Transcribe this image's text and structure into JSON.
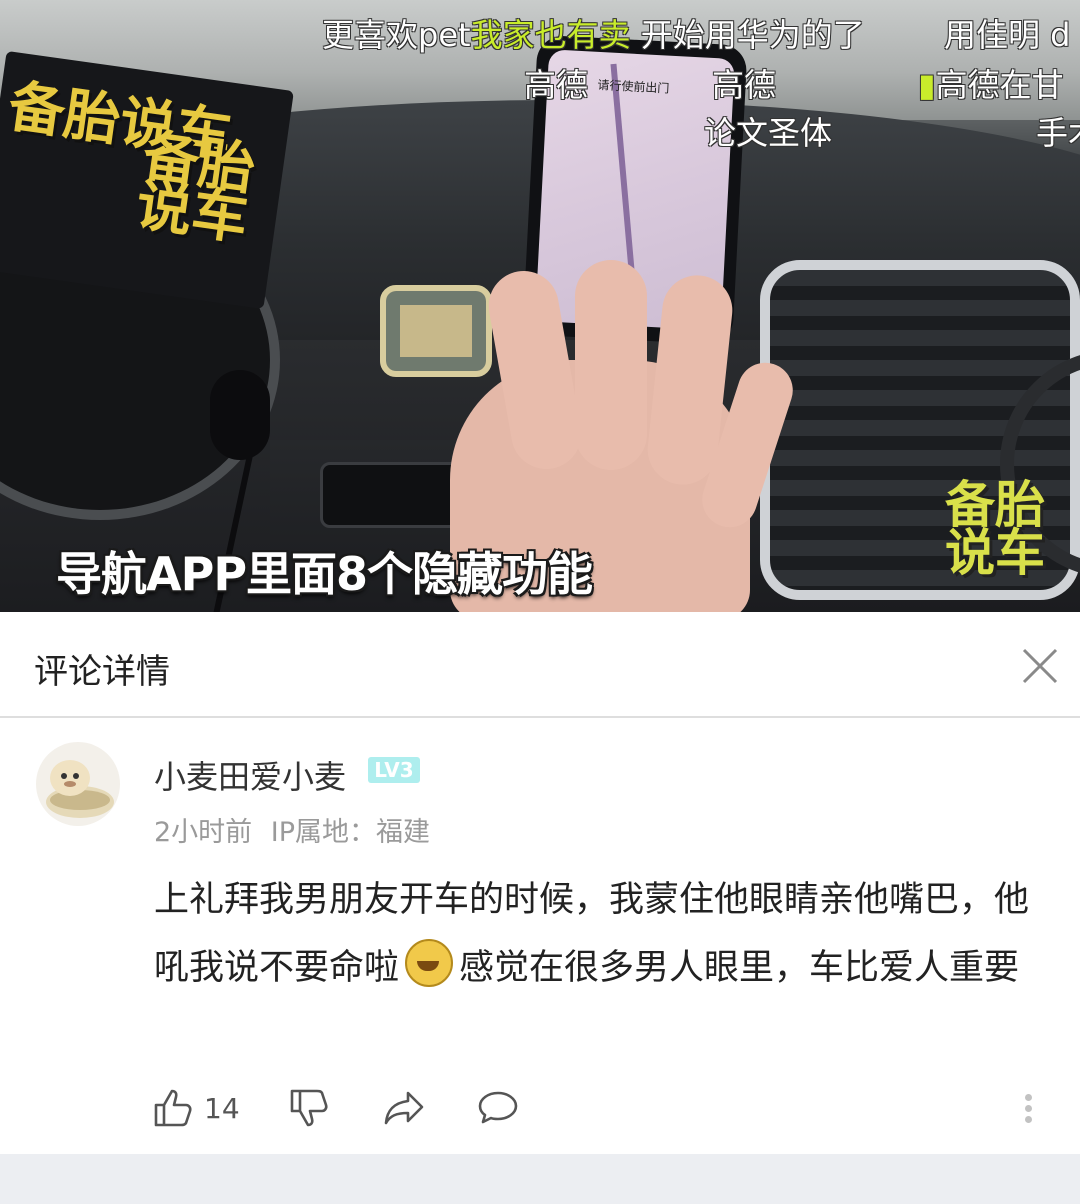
{
  "video": {
    "caption": "导航APP里面8个隐藏功能",
    "sign_text": "备胎说车",
    "watermark": "备胎说车",
    "phone_label": "请行使前出门",
    "danmaku": [
      {
        "pre": "更喜欢pet",
        "hl": "我家也有卖",
        "post": "开始用华为的了"
      },
      {
        "text": "用佳明 d"
      },
      {
        "text": "高德"
      },
      {
        "text": "高德"
      },
      {
        "text": "高德在甘"
      },
      {
        "text": "论文圣体"
      },
      {
        "text": "手术"
      }
    ]
  },
  "sheet": {
    "title": "评论详情"
  },
  "comment": {
    "username": "小麦田爱小麦",
    "level": "LV3",
    "time": "2小时前",
    "ip_location": "IP属地：福建",
    "content_before_emoji": "上礼拜我男朋友开车的时候，我蒙住他眼睛亲他嘴巴，他吼我说不要命啦",
    "emoji_name": "smiling-face-emoji",
    "content_after_emoji": "感觉在很多男人眼里，车比爱人重要",
    "like_count": "14"
  },
  "icons": {
    "close": "close-icon",
    "like": "thumbs-up-icon",
    "dislike": "thumbs-down-icon",
    "share": "share-icon",
    "reply": "comment-bubble-icon",
    "more": "more-vertical-icon"
  },
  "colors": {
    "danmaku_highlight": "#c9ec2b",
    "level_badge": "#aeeeee",
    "meta_text": "#9a9a9a"
  }
}
